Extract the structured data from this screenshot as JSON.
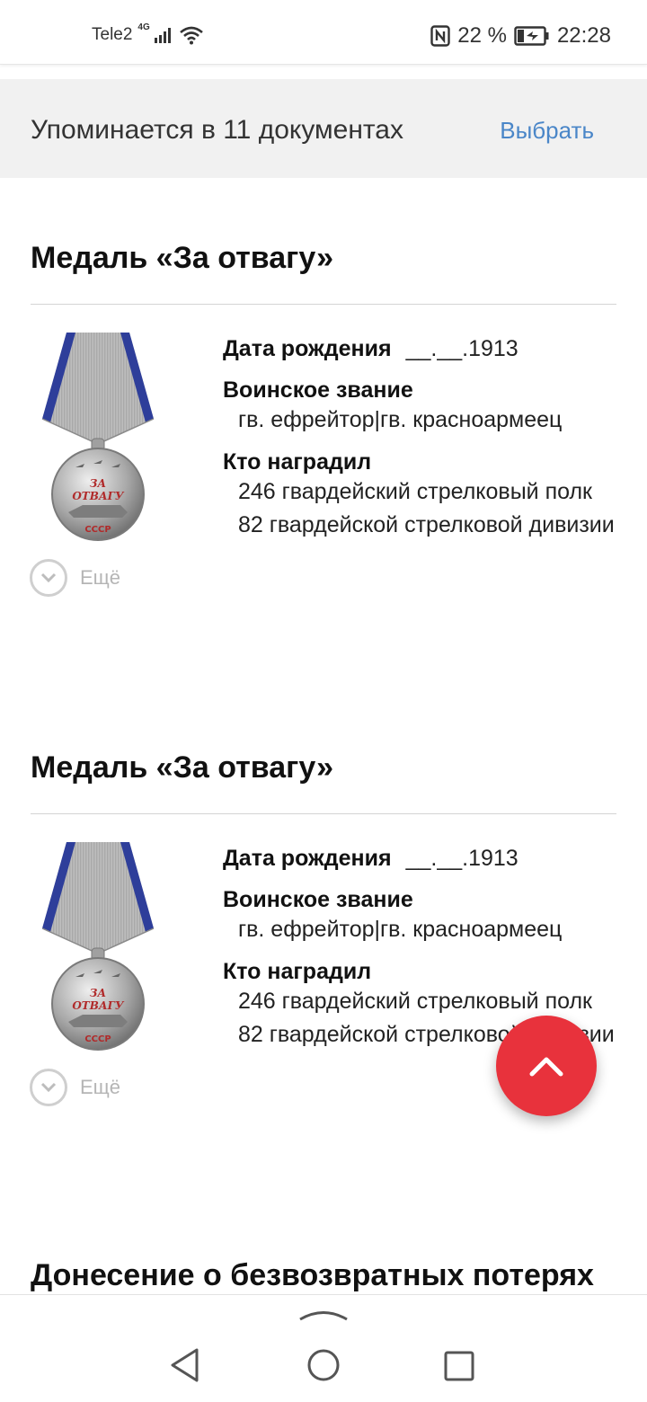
{
  "status_bar": {
    "carrier": "Tele2",
    "network": "4G",
    "battery": "22 %",
    "time": "22:28"
  },
  "mentions": {
    "text": "Упоминается в 11 документах",
    "choose_label": "Выбрать"
  },
  "cards": [
    {
      "title": "Медаль «За отвагу»",
      "birth_label": "Дата рождения",
      "birth_value": "__.__.1913",
      "rank_label": "Воинское звание",
      "rank_value": "гв. ефрейтор|гв. красноармеец",
      "awarder_label": "Кто наградил",
      "awarder_value": "246 гвардейский стрелковый полк 82 гвардейской стрелковой дивизии",
      "more_label": "Ещё"
    },
    {
      "title": "Медаль «За отвагу»",
      "birth_label": "Дата рождения",
      "birth_value": "__.__.1913",
      "rank_label": "Воинское звание",
      "rank_value": "гв. ефрейтор|гв. красноармеец",
      "awarder_label": "Кто наградил",
      "awarder_value": "246 гвардейский стрелковый полк 82 гвардейской стрелковой дивизии",
      "more_label": "Ещё"
    }
  ],
  "next_section_title": "Донесение о безвозвратных потерях",
  "medal": {
    "text_line1": "ЗА",
    "text_line2": "ОТВАГУ",
    "text_bottom": "СССР"
  },
  "icons": {
    "fab": "chevron-up-icon",
    "more": "chevron-down-icon",
    "nav_back": "triangle-back-icon",
    "nav_home": "circle-home-icon",
    "nav_recent": "square-recent-icon"
  },
  "colors": {
    "link": "#4a86c8",
    "fab": "#e8323c",
    "banner_bg": "#f1f1f1"
  }
}
